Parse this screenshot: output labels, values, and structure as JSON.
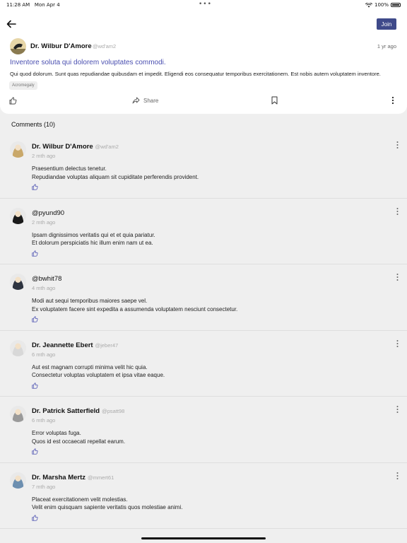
{
  "status_bar": {
    "time": "11:28 AM",
    "date": "Mon Apr 4",
    "battery": "100%"
  },
  "header": {
    "join_label": "Join"
  },
  "post": {
    "author": "Dr. Wilbur D'Amore",
    "handle": "@wd'am2",
    "time": "1 yr ago",
    "title": "Inventore soluta qui dolorem voluptates commodi.",
    "body": "Qui quod dolorum. Sunt quas repudiandae quibusdam et impedit. Eligendi eos consequatur temporibus exercitationem. Est nobis autem voluptatem inventore.",
    "tag": "Acromegaly",
    "share_label": "Share"
  },
  "comments_title": "Comments (10)",
  "comments": [
    {
      "name": "Dr. Wilbur D'Amore",
      "handle": "@wd'am2",
      "time": "2 mth ago",
      "line1": "Praesentium delectus tenetur.",
      "line2": "Repudiandae voluptas aliquam sit cupiditate perferendis provident.",
      "avatar_color": "#c9a86a"
    },
    {
      "name": "@pyund90",
      "handle": "",
      "time": "2 mth ago",
      "line1": "Ipsam dignissimos veritatis qui et et quia pariatur.",
      "line2": "Et dolorum perspiciatis hic illum enim nam ut ea.",
      "avatar_color": "#1a1a1a"
    },
    {
      "name": "@bwhit78",
      "handle": "",
      "time": "4 mth ago",
      "line1": "Modi aut sequi temporibus maiores saepe vel.",
      "line2": "Ex voluptatem facere sint expedita a assumenda voluptatem nesciunt consectetur.",
      "avatar_color": "#2e3440"
    },
    {
      "name": "Dr. Jeannette Ebert",
      "handle": "@jeber47",
      "time": "6 mth ago",
      "line1": "Aut est magnam corrupti minima velit hic quia.",
      "line2": "Consectetur voluptas voluptatem et ipsa vitae eaque.",
      "avatar_color": "#d8d8d8"
    },
    {
      "name": "Dr. Patrick Satterfield",
      "handle": "@psatt98",
      "time": "6 mth ago",
      "line1": "Error voluptas fuga.",
      "line2": "Quos id est occaecati repellat earum.",
      "avatar_color": "#9a9a9a"
    },
    {
      "name": "Dr. Marsha Mertz",
      "handle": "@mmert61",
      "time": "7 mth ago",
      "line1": "Placeat exercitationem velit molestias.",
      "line2": "Velit enim quisquam sapiente veritatis quos molestiae animi.",
      "avatar_color": "#6d8fb0"
    }
  ]
}
